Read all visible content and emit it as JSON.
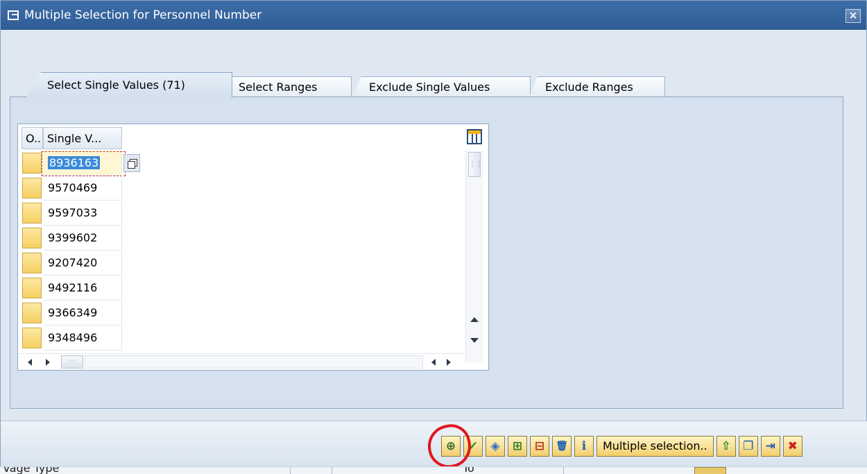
{
  "window": {
    "title": "Multiple Selection for Personnel Number",
    "close_label": "×"
  },
  "tabs": [
    {
      "label": "Select Single Values (71)",
      "active": true
    },
    {
      "label": "Select Ranges",
      "active": false
    },
    {
      "label": "Exclude Single Values",
      "active": false
    },
    {
      "label": "Exclude Ranges",
      "active": false
    }
  ],
  "grid": {
    "columns": [
      "O..",
      "Single V..."
    ],
    "rows": [
      "8936163",
      "9570469",
      "9597033",
      "9399602",
      "9207420",
      "9492116",
      "9366349",
      "9348496"
    ]
  },
  "toolbar": {
    "buttons": [
      {
        "icon": "import-icon",
        "glyph": "⊕"
      },
      {
        "icon": "checkmark-icon",
        "glyph": "✔"
      },
      {
        "icon": "execute-icon",
        "glyph": "◈"
      },
      {
        "icon": "insert-row-icon",
        "glyph": "⊞"
      },
      {
        "icon": "delete-row-icon",
        "glyph": "⊟"
      },
      {
        "icon": "trash-icon",
        "glyph": "🗑"
      },
      {
        "icon": "info-icon",
        "glyph": "i"
      }
    ],
    "multiple_selection_label": "Multiple selection..",
    "buttons_after": [
      {
        "icon": "upload-icon",
        "glyph": "⇧"
      },
      {
        "icon": "copy-clipboard-icon",
        "glyph": "❐"
      },
      {
        "icon": "paste-clipboard-icon",
        "glyph": "⇥"
      },
      {
        "icon": "cancel-icon",
        "glyph": "✖"
      }
    ]
  },
  "background": {
    "label": "Vage Type",
    "to_label": "To"
  },
  "colors": {
    "title_bar": "#2f5c95",
    "panel": "#d5e1ee",
    "button_gold": "#f2cf6c",
    "annotation_red": "#e0161f",
    "check_green": "#2e9a2e",
    "cancel_red": "#c8231b"
  }
}
